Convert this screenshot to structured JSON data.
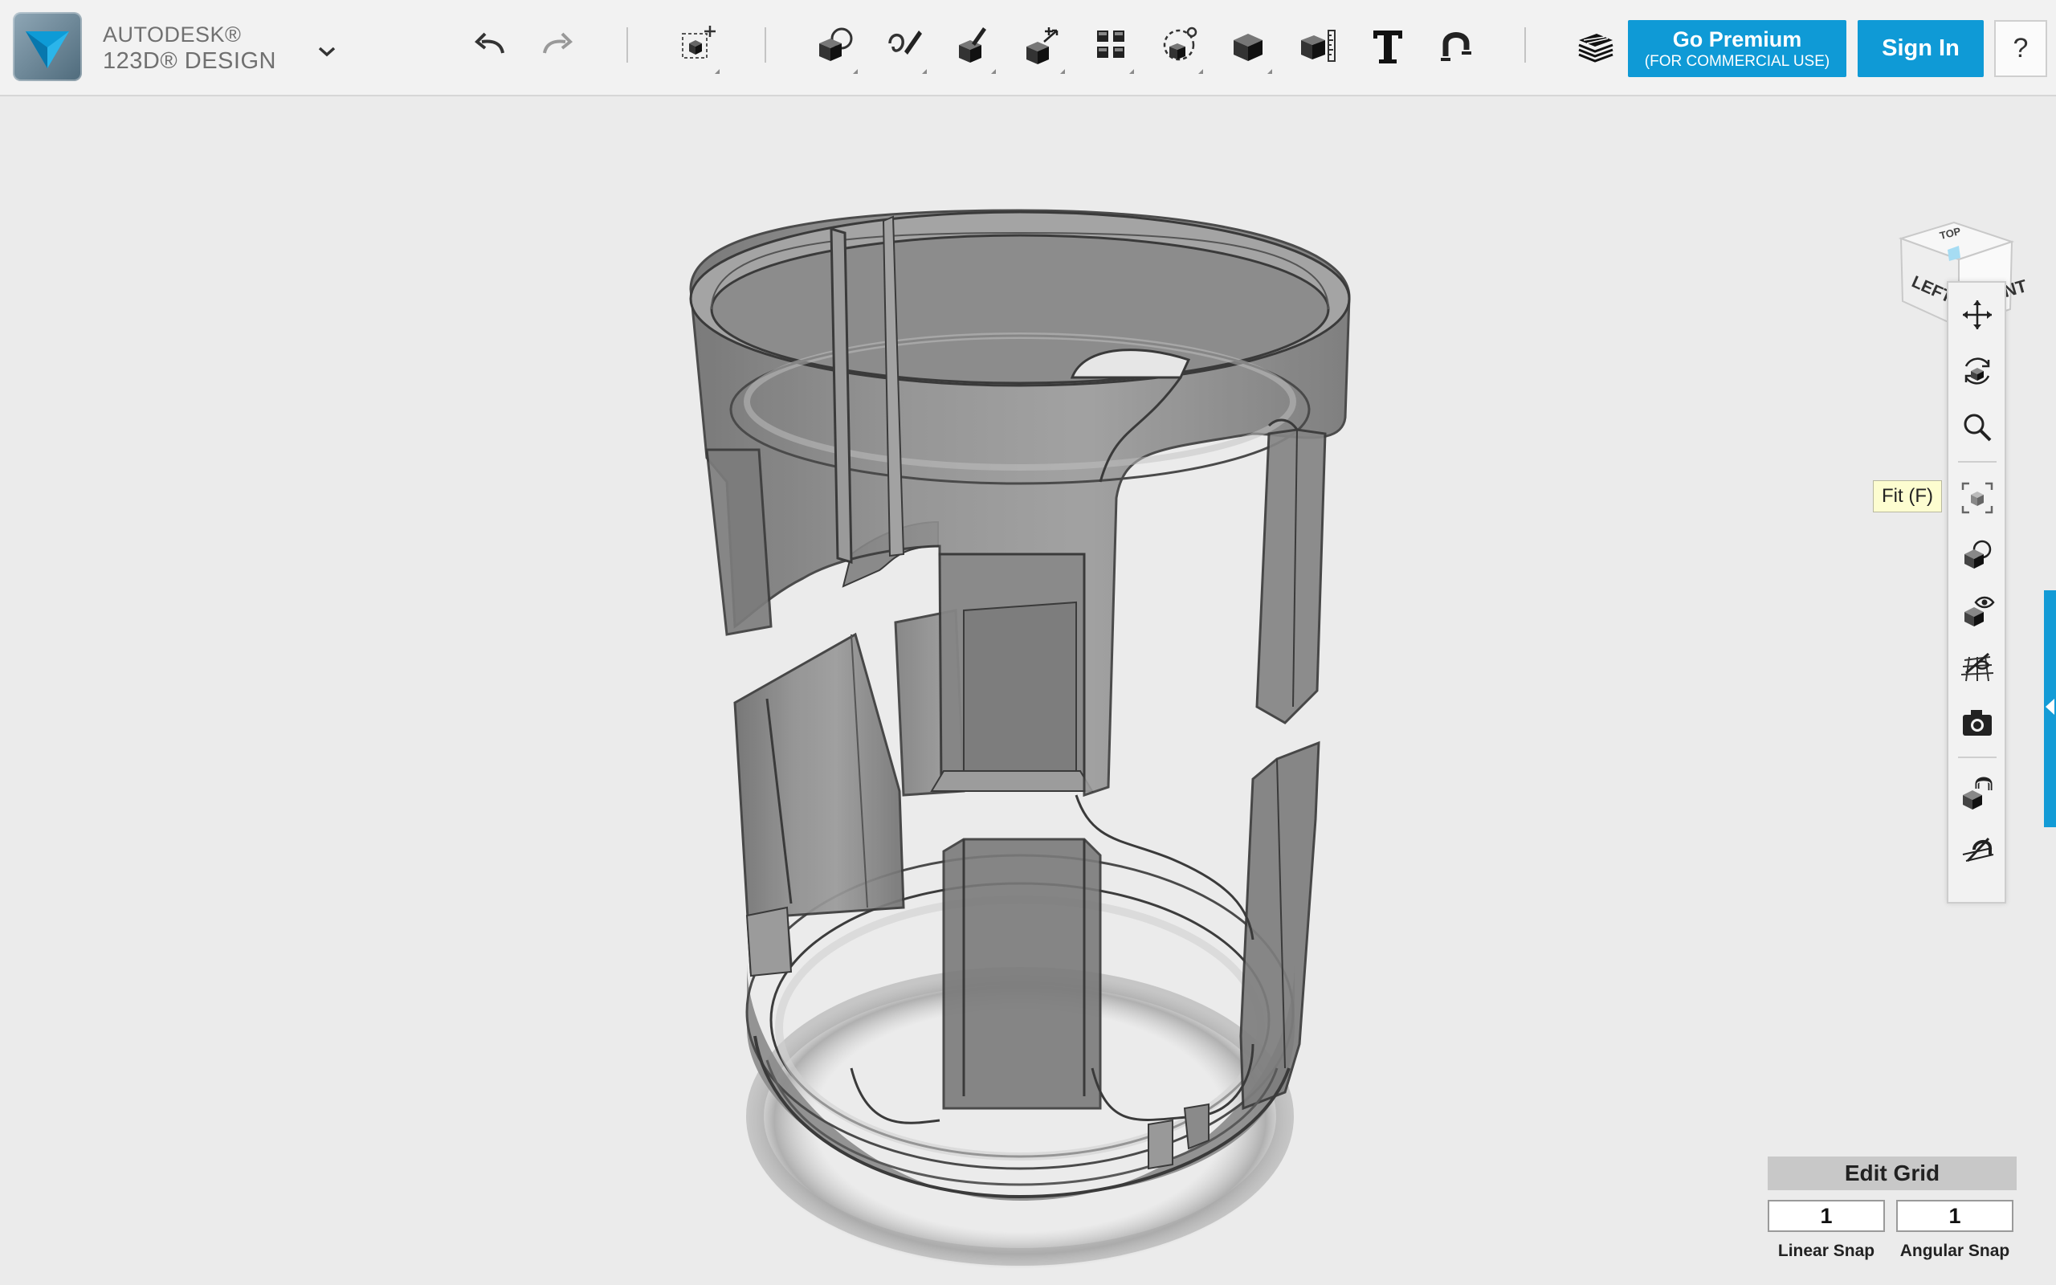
{
  "brand": {
    "line1": "AUTODESK®",
    "line2": "123D® DESIGN"
  },
  "toolbar": {
    "buttons": [
      {
        "name": "undo-icon"
      },
      {
        "name": "redo-icon"
      },
      {
        "name": "transform-icon"
      },
      {
        "name": "primitives-icon"
      },
      {
        "name": "sketch-icon"
      },
      {
        "name": "construct-icon"
      },
      {
        "name": "modify-icon"
      },
      {
        "name": "pattern-icon"
      },
      {
        "name": "grouping-icon"
      },
      {
        "name": "combine-icon"
      },
      {
        "name": "measure-icon"
      },
      {
        "name": "text-icon"
      },
      {
        "name": "snap-icon"
      },
      {
        "name": "materials-icon"
      }
    ],
    "premium_label": "Go Premium",
    "premium_sub": "(FOR COMMERCIAL USE)",
    "signin_label": "Sign In",
    "help_label": "?"
  },
  "viewcube": {
    "top": "TOP",
    "left": "LEFT",
    "front": "FRONT"
  },
  "nav": {
    "buttons": [
      "pan-icon",
      "orbit-icon",
      "zoom-icon",
      "fit-icon",
      "view-icon",
      "visibility-icon",
      "grid-icon",
      "camera-icon",
      "snap-icon",
      "material-icon"
    ],
    "tooltip": "Fit (F)"
  },
  "grid": {
    "title": "Edit Grid",
    "linear_value": "1",
    "angular_value": "1",
    "linear_label": "Linear Snap",
    "angular_label": "Angular Snap"
  },
  "colors": {
    "accent": "#0f9ad6",
    "toolbar_bg": "#f2f2f2",
    "viewport_bg": "#ebebeb"
  }
}
